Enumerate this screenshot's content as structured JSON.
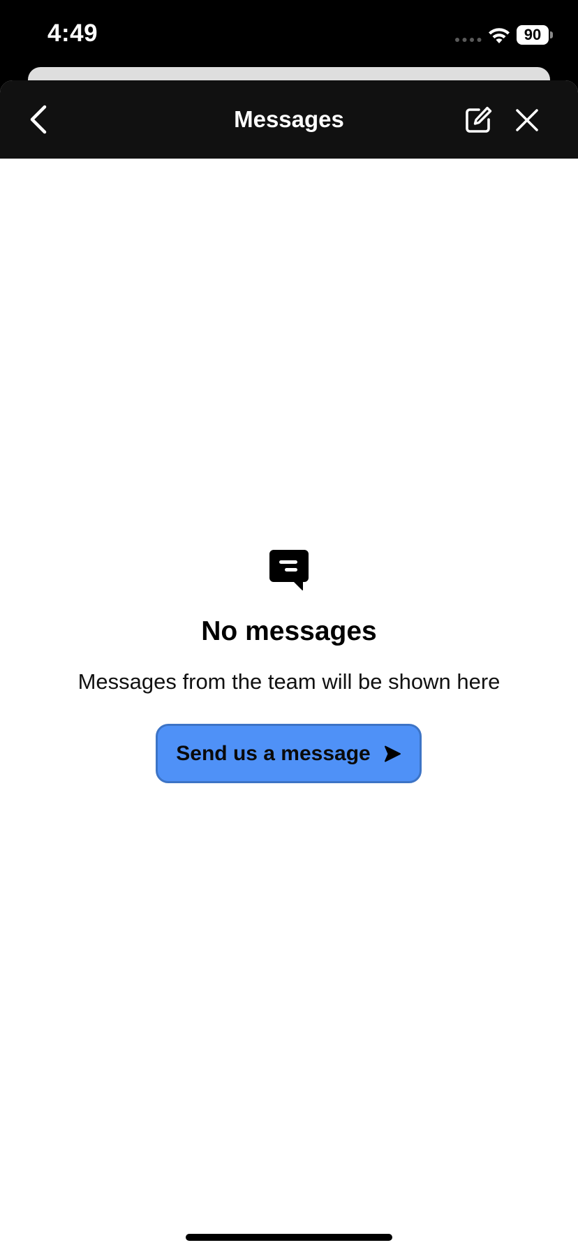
{
  "status_bar": {
    "time": "4:49",
    "battery_level": "90",
    "icons": [
      "signal-dots-icon",
      "wifi-icon",
      "battery-icon"
    ]
  },
  "header": {
    "title": "Messages",
    "back_icon": "chevron-left-icon",
    "compose_icon": "compose-icon",
    "close_icon": "close-icon"
  },
  "empty_state": {
    "icon": "chat-bubble-icon",
    "title": "No messages",
    "subtitle": "Messages from the team will be shown here",
    "button_label": "Send us a message",
    "button_icon": "send-arrow-icon"
  },
  "colors": {
    "header_background": "#111111",
    "button_background": "#4f91f7",
    "button_border": "#3d74c6",
    "page_background": "#ffffff"
  }
}
